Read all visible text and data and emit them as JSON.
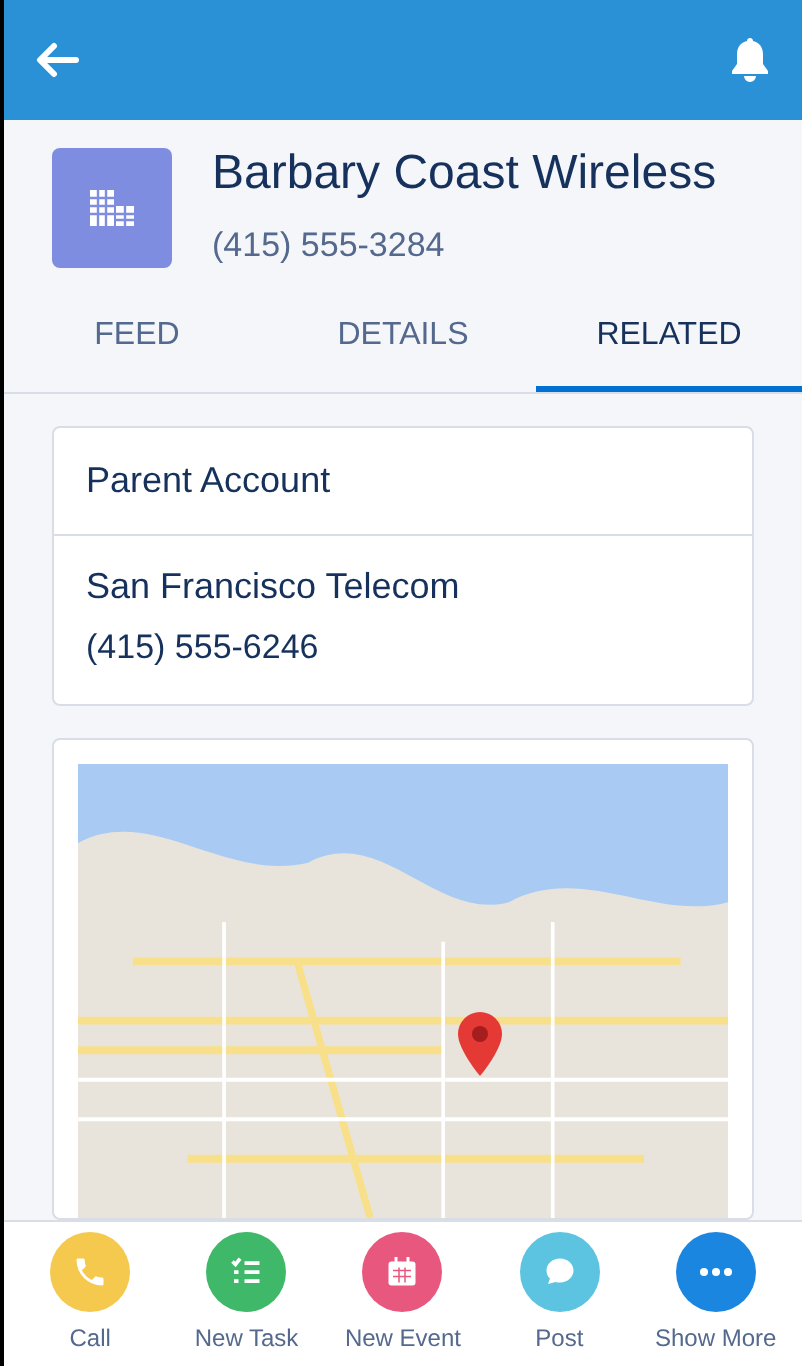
{
  "record": {
    "name": "Barbary Coast Wireless",
    "phone": "(415) 555-3284"
  },
  "tabs": [
    {
      "label": "FEED",
      "selected": false
    },
    {
      "label": "DETAILS",
      "selected": false
    },
    {
      "label": "RELATED",
      "selected": true
    }
  ],
  "parent_account": {
    "heading": "Parent Account",
    "name": "San Francisco Telecom",
    "phone": "(415) 555-6246"
  },
  "actions": [
    {
      "kind": "call",
      "label": "Call",
      "color": "#f4c94e"
    },
    {
      "kind": "task",
      "label": "New Task",
      "color": "#3fb86a"
    },
    {
      "kind": "event",
      "label": "New Event",
      "color": "#e8577e"
    },
    {
      "kind": "post",
      "label": "Post",
      "color": "#5cc4e0"
    },
    {
      "kind": "more",
      "label": "Show More",
      "color": "#1b86e0"
    }
  ]
}
